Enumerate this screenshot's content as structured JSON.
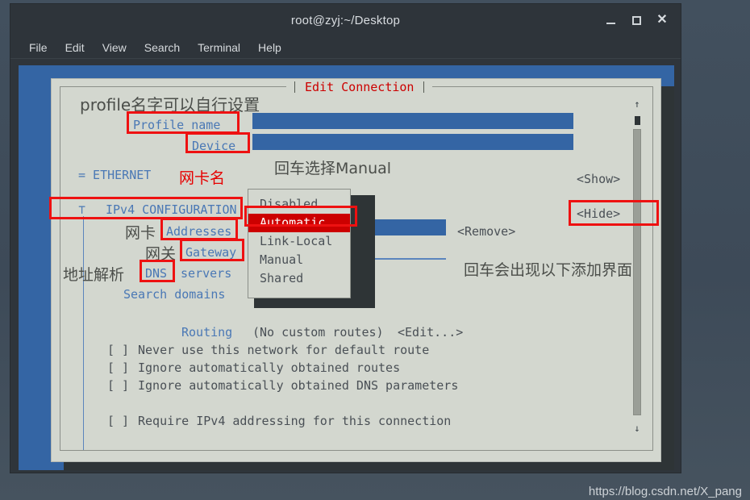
{
  "window": {
    "title": "root@zyj:~/Desktop",
    "buttons": {
      "minimize": "minimize-icon",
      "maximize": "maximize-icon",
      "close": "close-icon"
    },
    "menu": [
      "File",
      "Edit",
      "View",
      "Search",
      "Terminal",
      "Help"
    ]
  },
  "colors": {
    "terminal_bg": "#3465a4",
    "dialog_bg": "#d3d7cf",
    "accent_red": "#cc0000",
    "annotation_red": "#e60000",
    "tui_blue": "#4a78b5",
    "shadow": "#2e3436"
  },
  "dialog": {
    "title": "Edit Connection",
    "labels": {
      "profile_name": "Profile name",
      "device": "Device",
      "ethernet_section": "= ETHERNET",
      "ipv4_section": "IPv4 CONFIGURATION",
      "addresses": "Addresses",
      "gateway": "Gateway",
      "dns_servers_dns": "DNS",
      "dns_servers_rest": " servers",
      "search_domains": "Search domains",
      "routing": "Routing",
      "routing_note": "(No custom routes)",
      "routing_edit": "<Edit...>"
    },
    "buttons": {
      "show": "<Show>",
      "hide": "<Hide>",
      "remove": "<Remove>"
    },
    "checkboxes": [
      {
        "box": "[ ]",
        "label": "Never use this network for default route"
      },
      {
        "box": "[ ]",
        "label": "Ignore automatically obtained routes"
      },
      {
        "box": "[ ]",
        "label": "Ignore automatically obtained DNS parameters"
      },
      {
        "box": "[ ]",
        "label": "Require IPv4 addressing for this connection"
      }
    ],
    "fields": {
      "profile_name_value": "",
      "device_value": "",
      "addresses_value": "",
      "gateway_value": "",
      "dns_value": "",
      "search_domains_value": ""
    }
  },
  "dropdown": {
    "name": "ipv4-configuration-method",
    "selected": "Automatic",
    "options": [
      "Disabled",
      "Automatic",
      "Link-Local",
      "Manual",
      "Shared"
    ]
  },
  "annotations": [
    {
      "id": "profile-name-note",
      "text": "profile名字可以自行设置",
      "color": "#4b4e4a"
    },
    {
      "id": "nic-name-note",
      "text": "网卡名",
      "color": "#e60000"
    },
    {
      "id": "enter-select-manual-note",
      "text": "回车选择Manual",
      "color": "#4b4e4a"
    },
    {
      "id": "nic-note",
      "text": "网卡",
      "color": "#4b4e4a"
    },
    {
      "id": "gateway-note",
      "text": "网关",
      "color": "#4b4e4a"
    },
    {
      "id": "address-resolve-note",
      "text": "地址解析",
      "color": "#4b4e4a"
    },
    {
      "id": "enter-shows-add-ui-note",
      "text": "回车会出现以下添加界面",
      "color": "#4b4e4a"
    }
  ],
  "scrollbar": {
    "up_arrow": "↑",
    "down_arrow": "↓"
  },
  "watermark": "https://blog.csdn.net/X_pang"
}
